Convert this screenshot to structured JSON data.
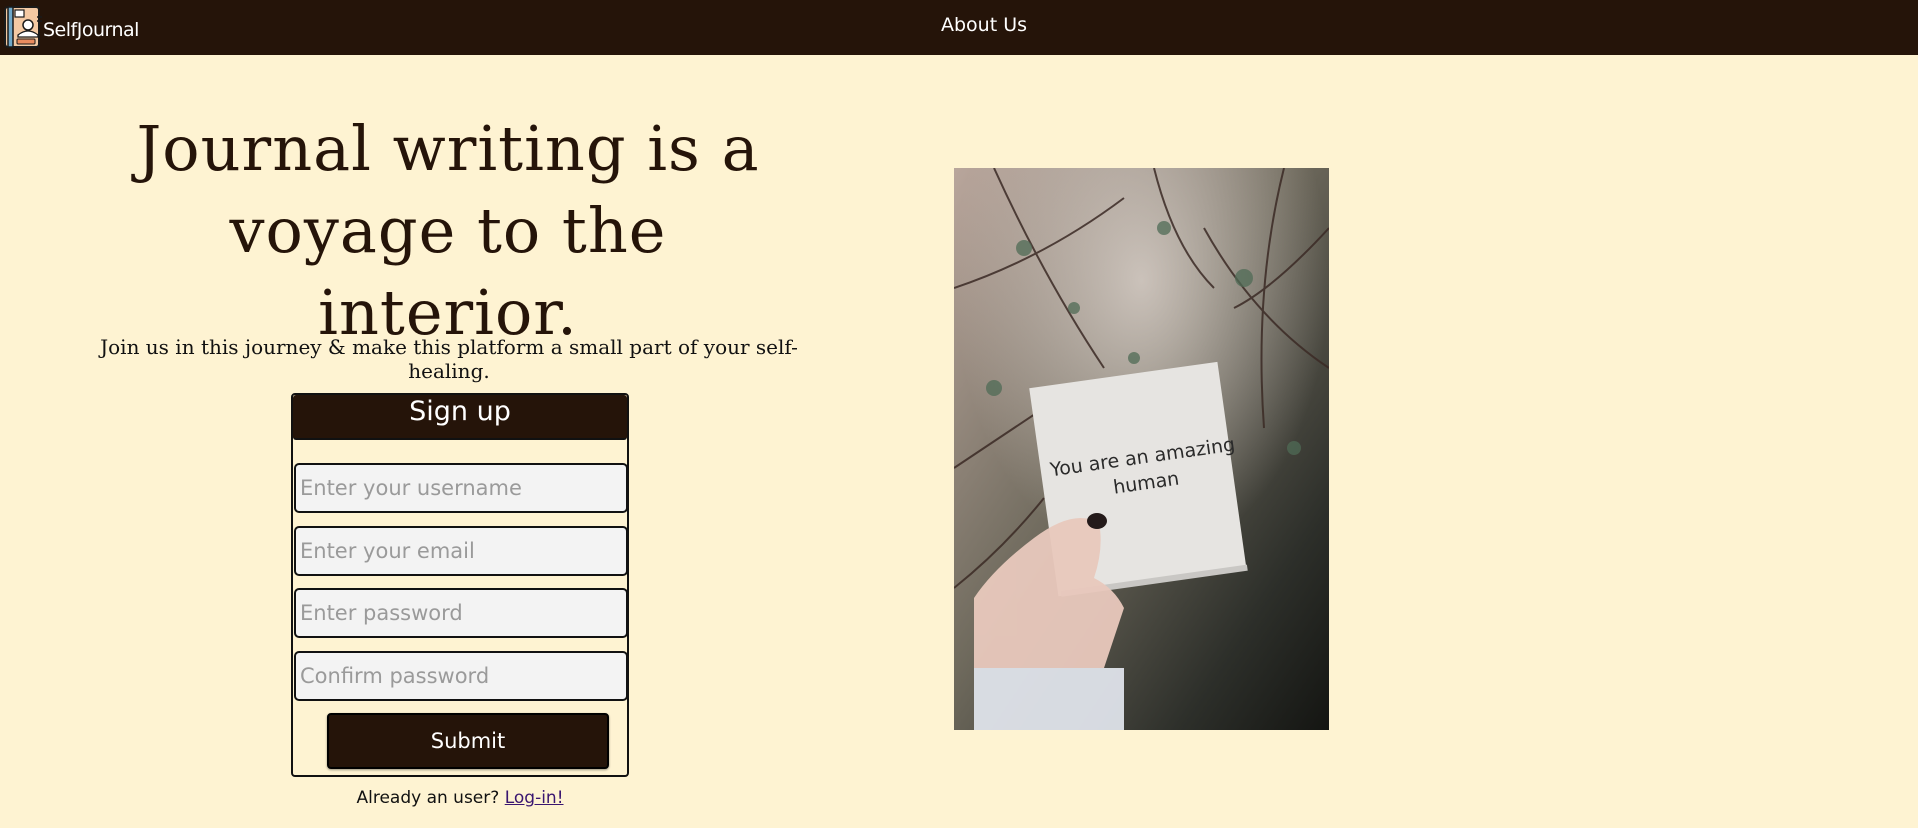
{
  "navbar": {
    "brand_name": "SelfJournal",
    "logo_icon": "journal-logo-icon",
    "about_link": "About Us"
  },
  "hero": {
    "quote_line1": "Journal writing is a",
    "quote_line2": "voyage to the interior.",
    "tagline": "Join us in this journey & make this platform a small part of your self-healing."
  },
  "signup": {
    "title": "Sign up",
    "username_placeholder": "Enter your username",
    "email_placeholder": "Enter your email",
    "password_placeholder": "Enter password",
    "confirm_placeholder": "Confirm password",
    "submit_label": "Submit"
  },
  "login": {
    "prompt": "Already an user?",
    "link_label": "Log-in!"
  },
  "image": {
    "note_text_line1": "You are an amazing",
    "note_text_line2": "human"
  },
  "colors": {
    "background": "#fef3d2",
    "dark_brown": "#251409",
    "link": "#3a1670"
  }
}
